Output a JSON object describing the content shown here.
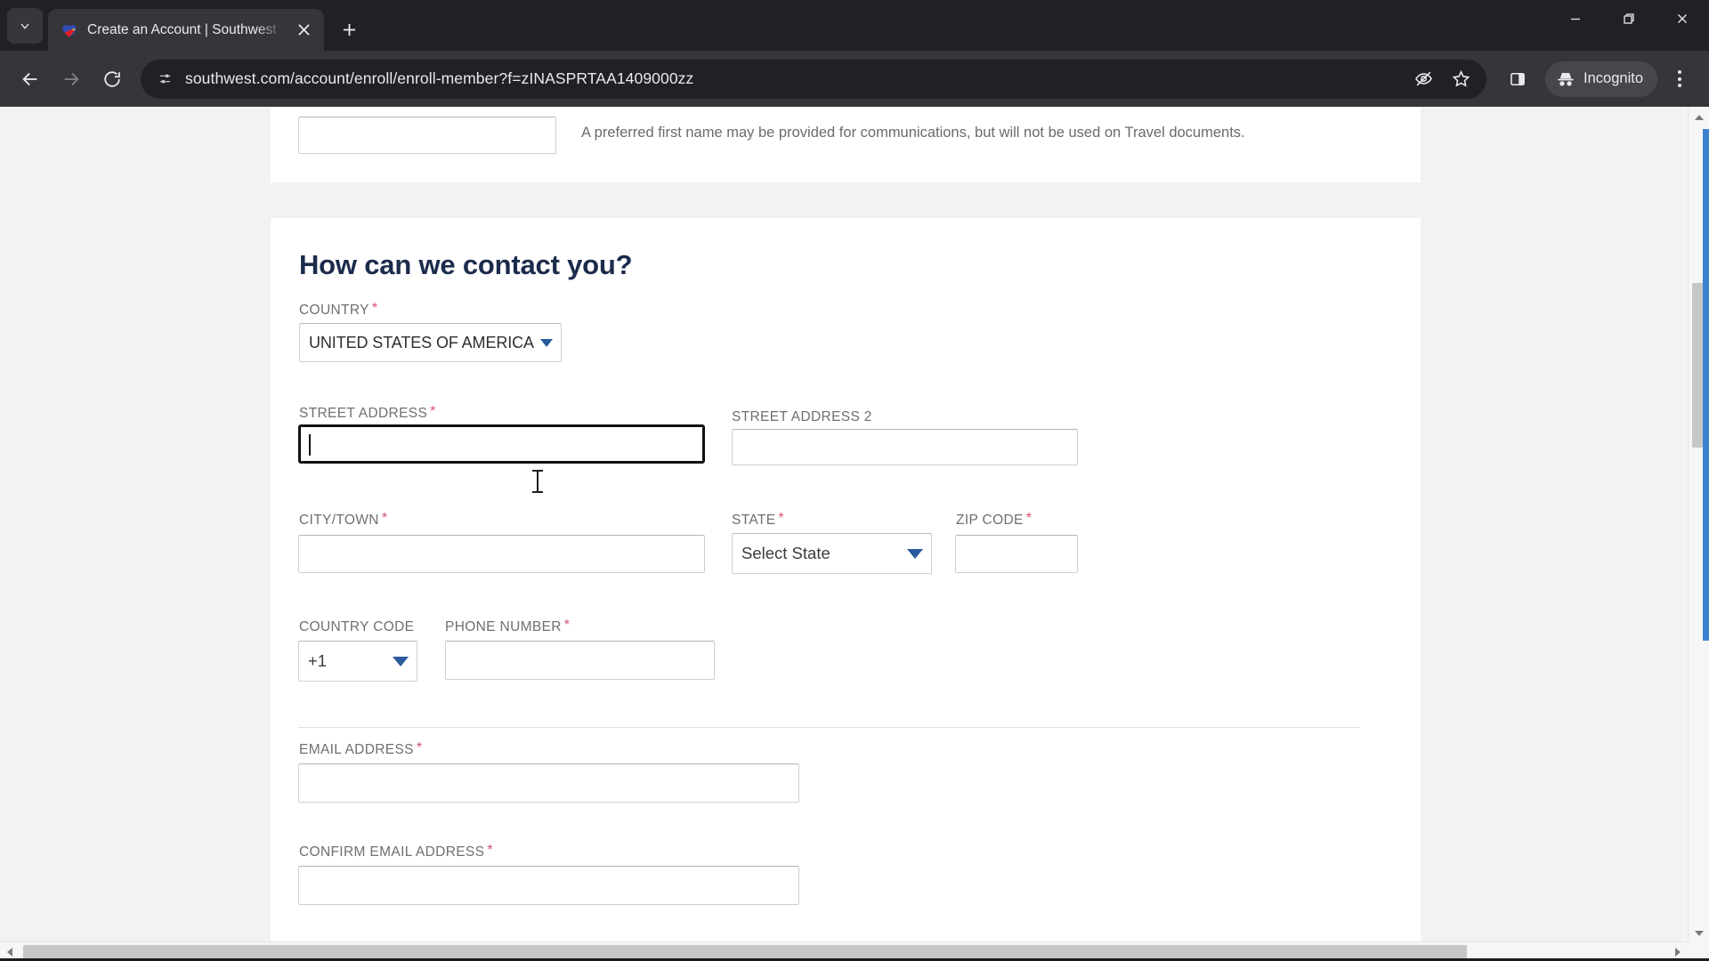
{
  "browser": {
    "tab": {
      "title": "Create an Account | Southwest",
      "favicon_icon": "southwest-heart-icon",
      "close_icon": "close-icon",
      "search_tabs_icon": "chevron-down-icon",
      "new_tab_icon": "plus-icon"
    },
    "window_controls": {
      "minimize_icon": "minimize-icon",
      "restore_icon": "restore-icon",
      "close_icon": "close-icon"
    },
    "toolbar": {
      "back_icon": "arrow-left-icon",
      "forward_icon": "arrow-right-icon",
      "reload_icon": "reload-icon",
      "site_info_icon": "tune-sliders-icon",
      "url": "southwest.com/account/enroll/enroll-member?f=zINASPRTAA1409000zz",
      "tracking_protection_icon": "eye-slash-icon",
      "bookmark_icon": "star-icon",
      "side_panel_icon": "side-panel-icon",
      "incognito_label": "Incognito",
      "incognito_icon": "incognito-hat-icon",
      "menu_icon": "kebab-menu-icon"
    }
  },
  "page": {
    "preferred_name": {
      "input_value": "",
      "hint": "A preferred first name may be provided for communications, but will not be used on Travel documents."
    },
    "contact_section": {
      "title": "How can we contact you?",
      "country": {
        "label": "COUNTRY",
        "required_mark": "*",
        "value": "UNITED STATES OF AMERICA",
        "dropdown_icon": "chevron-down-icon"
      },
      "street_address": {
        "label": "STREET ADDRESS",
        "required_mark": "*",
        "value": "",
        "focused": true
      },
      "street_address_2": {
        "label": "STREET ADDRESS 2",
        "required_mark": "",
        "value": ""
      },
      "city_town": {
        "label": "CITY/TOWN",
        "required_mark": "*",
        "value": ""
      },
      "state": {
        "label": "STATE",
        "required_mark": "*",
        "value": "Select State",
        "dropdown_icon": "chevron-down-icon"
      },
      "zip_code": {
        "label": "ZIP CODE",
        "required_mark": "*",
        "value": ""
      },
      "country_code": {
        "label": "COUNTRY CODE",
        "required_mark": "",
        "value": "+1",
        "dropdown_icon": "chevron-down-icon"
      },
      "phone_number": {
        "label": "PHONE NUMBER",
        "required_mark": "*",
        "value": ""
      },
      "email_address": {
        "label": "EMAIL ADDRESS",
        "required_mark": "*",
        "value": ""
      },
      "confirm_email_address": {
        "label": "CONFIRM EMAIL ADDRESS",
        "required_mark": "*",
        "value": ""
      }
    }
  },
  "scrollbars": {
    "vertical_up_icon": "caret-up-icon",
    "vertical_down_icon": "caret-down-icon",
    "horizontal_left_icon": "caret-left-icon",
    "horizontal_right_icon": "caret-right-icon"
  },
  "colors": {
    "brand_navy": "#1b2b4b",
    "accent_blue": "#2a5a9e",
    "required_red": "#d4526e",
    "chrome_dark": "#35363a",
    "focus_blue": "#3d82d1"
  }
}
